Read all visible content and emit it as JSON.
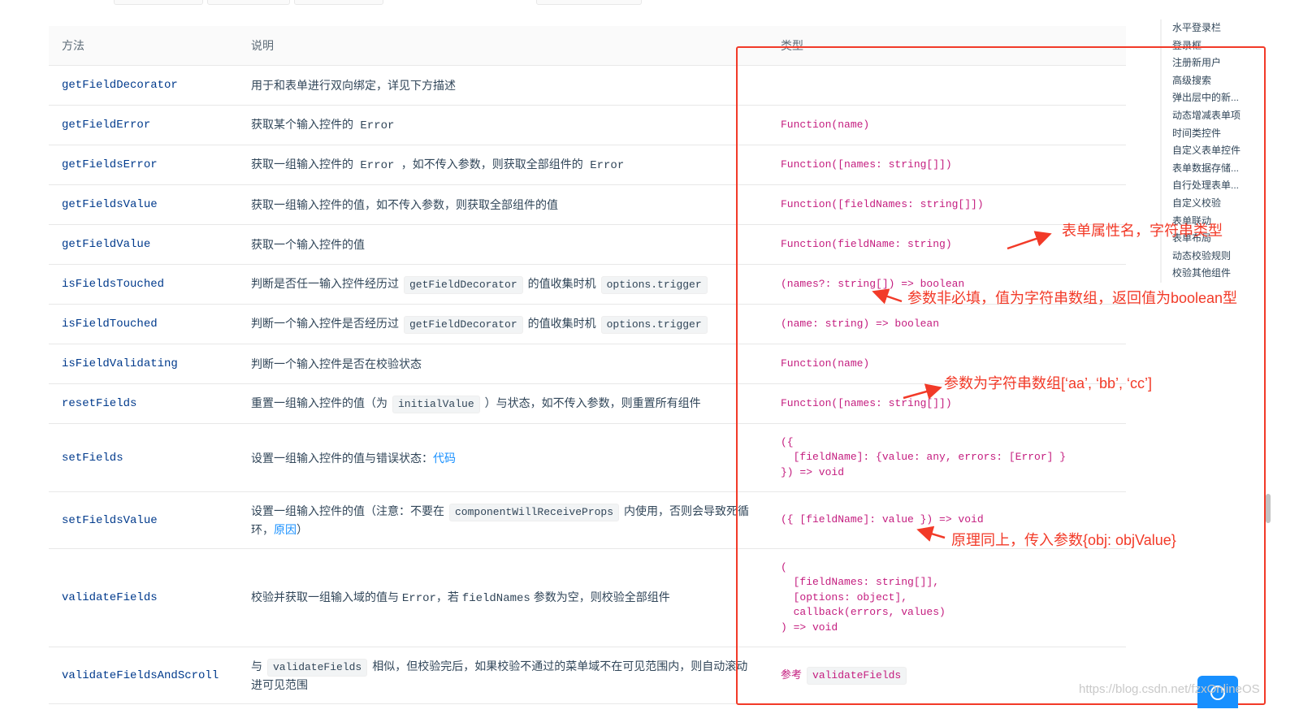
{
  "table": {
    "headers": [
      "方法",
      "说明",
      "类型"
    ],
    "rows": [
      {
        "method": "getFieldDecorator",
        "desc": [
          "用于和表单进行双向绑定，详见下方描述"
        ],
        "type": ""
      },
      {
        "method": "getFieldError",
        "desc": [
          "获取某个输入控件的 Error"
        ],
        "type": "Function(name)"
      },
      {
        "method": "getFieldsError",
        "desc": [
          "获取一组输入控件的 Error ，如不传入参数，则获取全部组件的 Error"
        ],
        "type": "Function([names: string[]])"
      },
      {
        "method": "getFieldsValue",
        "desc": [
          "获取一组输入控件的值，如不传入参数，则获取全部组件的值"
        ],
        "type": "Function([fieldNames: string[]])"
      },
      {
        "method": "getFieldValue",
        "desc": [
          "获取一个输入控件的值"
        ],
        "type": "Function(fieldName: string)"
      },
      {
        "method": "isFieldsTouched",
        "desc": [
          "判断是否任一输入控件经历过",
          "getFieldDecorator",
          "的值收集时机",
          "options.trigger"
        ],
        "type": "(names?: string[]) => boolean"
      },
      {
        "method": "isFieldTouched",
        "desc": [
          "判断一个输入控件是否经历过",
          "getFieldDecorator",
          "的值收集时机",
          "options.trigger"
        ],
        "type": "(name: string) => boolean"
      },
      {
        "method": "isFieldValidating",
        "desc": [
          "判断一个输入控件是否在校验状态"
        ],
        "type": "Function(name)"
      },
      {
        "method": "resetFields",
        "desc": [
          "重置一组输入控件的值（为",
          "initialValue",
          "）与状态，如不传入参数，则重置所有组件"
        ],
        "type": "Function([names: string[]])"
      },
      {
        "method": "setFields",
        "desc": [
          "设置一组输入控件的值与错误状态：",
          "代码"
        ],
        "type": "({\n  [fieldName]: {value: any, errors: [Error] }\n}) => void"
      },
      {
        "method": "setFieldsValue",
        "desc": [
          "设置一组输入控件的值（注意：不要在",
          "componentWillReceiveProps",
          "内使用，否则会导致死循环，",
          "原因",
          "）"
        ],
        "type": "({ [fieldName]: value }) => void"
      },
      {
        "method": "validateFields",
        "desc": [
          "校验并获取一组输入域的值与 ",
          "Error",
          "，若 ",
          "fieldNames",
          " 参数为空，则校验全部组件"
        ],
        "type": "(\n  [fieldNames: string[]],\n  [options: object],\n  callback(errors, values)\n) => void"
      },
      {
        "method": "validateFieldsAndScroll",
        "desc": [
          "与",
          "validateFields",
          "相似，但校验完后，如果校验不通过的菜单域不在可见范围内，则自动滚动进可见范围"
        ],
        "type_prefix": "参考",
        "type_code": "validateFields"
      }
    ]
  },
  "anchor_nav": [
    "水平登录栏",
    "登录框",
    "注册新用户",
    "高级搜索",
    "弹出层中的新...",
    "动态增减表单项",
    "时间类控件",
    "自定义表单控件",
    "表单数据存储...",
    "自行处理表单...",
    "自定义校验",
    "表单联动",
    "表单布局",
    "动态校验规则",
    "校验其他组件"
  ],
  "annotations": {
    "a1": "表单属性名，字符串类型",
    "a2": "参数非必填，值为字符串数组，返回值为boolean型",
    "a3": "参数为字符串数组[‘aa’, ‘bb’, ‘cc’]",
    "a4": "原理同上，传入参数{obj: objValue}"
  },
  "watermark": "https://blog.csdn.net/fzxOnlineOS",
  "colors": {
    "method": "#003a8c",
    "type": "#c41d7f",
    "link": "#1890ff",
    "annotation": "#f23a28"
  }
}
